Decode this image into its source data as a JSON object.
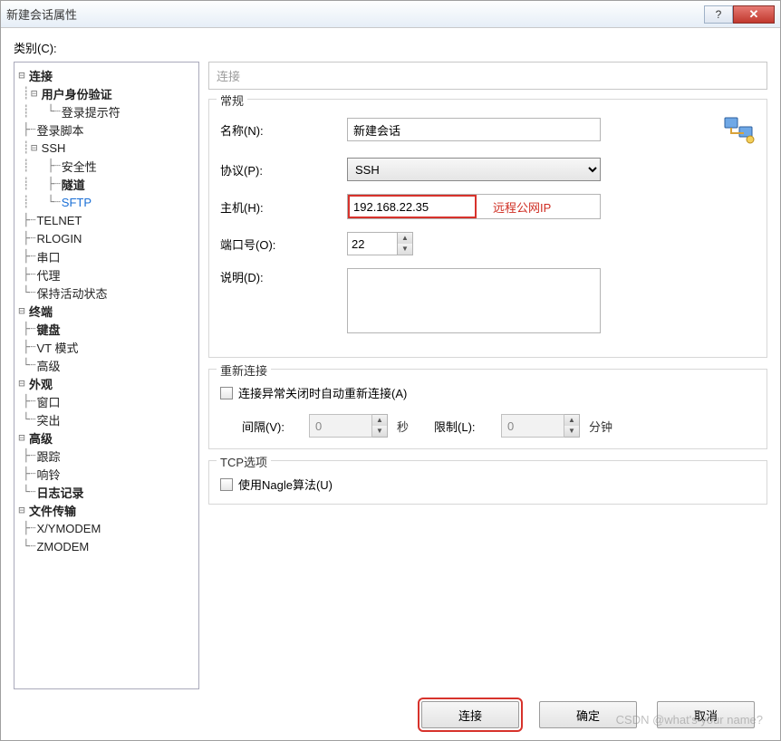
{
  "title": "新建会话属性",
  "category_label": "类别(C):",
  "tree": {
    "connection": "连接",
    "auth": "用户身份验证",
    "login_prompt": "登录提示符",
    "login_script": "登录脚本",
    "ssh": "SSH",
    "security": "安全性",
    "tunnel": "隧道",
    "sftp": "SFTP",
    "telnet": "TELNET",
    "rlogin": "RLOGIN",
    "serial": "串口",
    "proxy": "代理",
    "keepalive": "保持活动状态",
    "terminal": "终端",
    "keyboard": "键盘",
    "vt": "VT 模式",
    "advanced_term": "高级",
    "appearance": "外观",
    "window": "窗口",
    "highlight": "突出",
    "advanced": "高级",
    "trace": "跟踪",
    "bell": "响铃",
    "logging": "日志记录",
    "filetrans": "文件传输",
    "xymodem": "X/YMODEM",
    "zmodem": "ZMODEM"
  },
  "path": "连接",
  "group_general": "常规",
  "labels": {
    "name": "名称(N):",
    "protocol": "协议(P):",
    "host": "主机(H):",
    "port": "端口号(O):",
    "desc": "说明(D):"
  },
  "values": {
    "name": "新建会话",
    "protocol": "SSH",
    "host": "192.168.22.35",
    "host_note": "远程公网IP",
    "port": "22"
  },
  "group_reconnect": "重新连接",
  "reconnect": {
    "chk": "连接异常关闭时自动重新连接(A)",
    "interval_label": "间隔(V):",
    "interval_value": "0",
    "interval_unit": "秒",
    "limit_label": "限制(L):",
    "limit_value": "0",
    "limit_unit": "分钟"
  },
  "group_tcp": "TCP选项",
  "tcp": {
    "nagle": "使用Nagle算法(U)"
  },
  "buttons": {
    "connect": "连接",
    "ok": "确定",
    "cancel": "取消"
  },
  "watermark": "CSDN @what's your name?"
}
